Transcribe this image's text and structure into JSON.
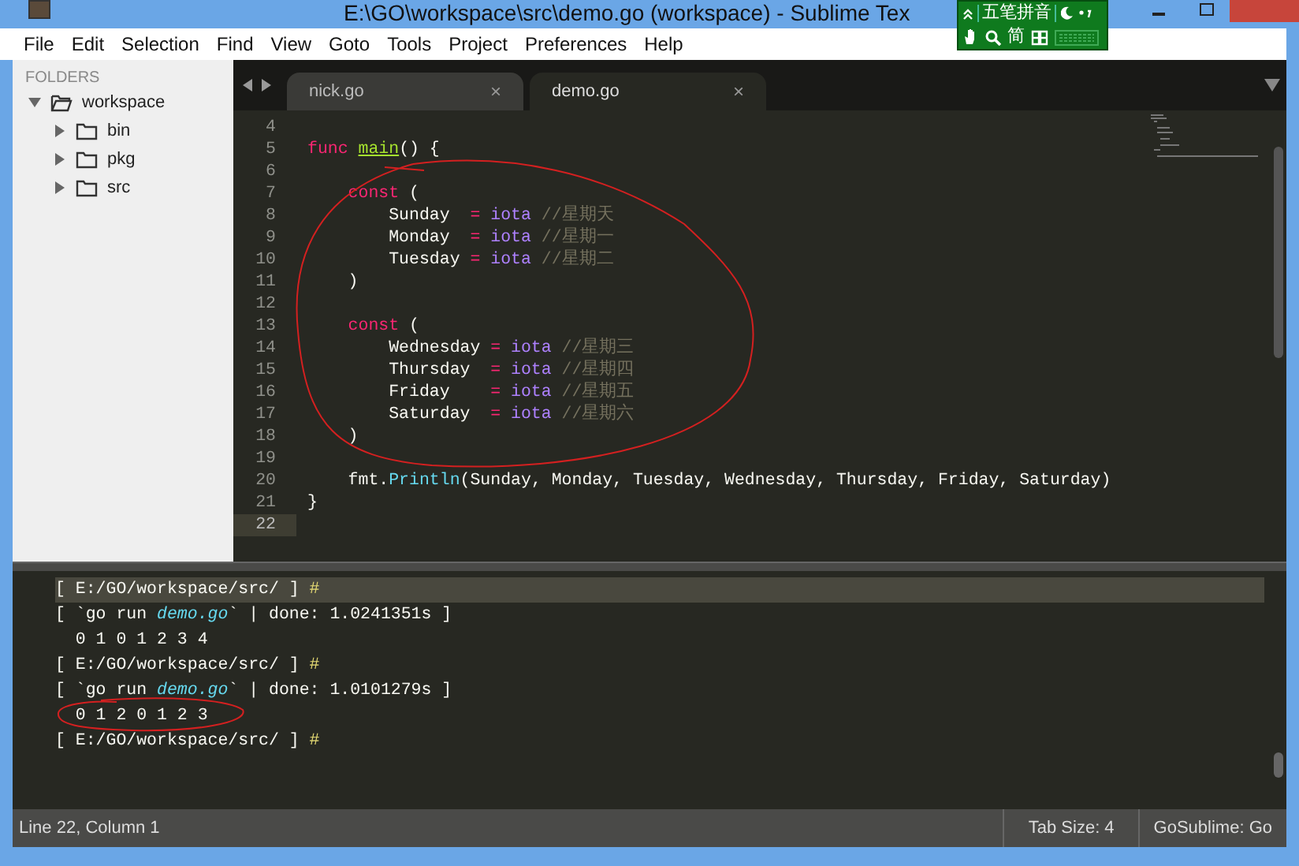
{
  "window": {
    "title": "E:\\GO\\workspace\\src\\demo.go (workspace) - Sublime Tex"
  },
  "ime_toolbar": {
    "mode": "五笔拼音",
    "charset": "简"
  },
  "menu": [
    "File",
    "Edit",
    "Selection",
    "Find",
    "View",
    "Goto",
    "Tools",
    "Project",
    "Preferences",
    "Help"
  ],
  "sidebar": {
    "heading": "FOLDERS",
    "tree": [
      {
        "label": "workspace",
        "expanded": true,
        "children": [
          {
            "label": "bin",
            "expanded": false
          },
          {
            "label": "pkg",
            "expanded": false
          },
          {
            "label": "src",
            "expanded": false
          }
        ]
      }
    ]
  },
  "tabs": [
    {
      "label": "nick.go",
      "selected": false,
      "close": "×"
    },
    {
      "label": "demo.go",
      "selected": true,
      "close": "×"
    }
  ],
  "editor": {
    "lines": [
      {
        "number": "4",
        "current": false
      },
      {
        "number": "5",
        "current": false,
        "tokens": [
          {
            "kind": "keyword",
            "text": "func "
          },
          {
            "kind": "function",
            "text": "main"
          },
          {
            "kind": "plain",
            "text": "() {"
          }
        ]
      },
      {
        "number": "6",
        "current": false
      },
      {
        "number": "7",
        "current": false,
        "tokens": [
          {
            "kind": "keyword",
            "text": "    const"
          },
          {
            "kind": "plain",
            "text": " ("
          }
        ]
      },
      {
        "number": "8",
        "current": false,
        "tokens": [
          {
            "kind": "plain",
            "text": "        Sunday  "
          },
          {
            "kind": "operator",
            "text": "= "
          },
          {
            "kind": "constant",
            "text": "iota "
          },
          {
            "kind": "comment",
            "text": "//星期天"
          }
        ]
      },
      {
        "number": "9",
        "current": false,
        "tokens": [
          {
            "kind": "plain",
            "text": "        Monday  "
          },
          {
            "kind": "operator",
            "text": "= "
          },
          {
            "kind": "constant",
            "text": "iota "
          },
          {
            "kind": "comment",
            "text": "//星期一"
          }
        ]
      },
      {
        "number": "10",
        "current": false,
        "tokens": [
          {
            "kind": "plain",
            "text": "        Tuesday "
          },
          {
            "kind": "operator",
            "text": "= "
          },
          {
            "kind": "constant",
            "text": "iota "
          },
          {
            "kind": "comment",
            "text": "//星期二"
          }
        ]
      },
      {
        "number": "11",
        "current": false,
        "tokens": [
          {
            "kind": "plain",
            "text": "    )"
          }
        ]
      },
      {
        "number": "12",
        "current": false
      },
      {
        "number": "13",
        "current": false,
        "tokens": [
          {
            "kind": "keyword",
            "text": "    const"
          },
          {
            "kind": "plain",
            "text": " ("
          }
        ]
      },
      {
        "number": "14",
        "current": false,
        "tokens": [
          {
            "kind": "plain",
            "text": "        Wednesday "
          },
          {
            "kind": "operator",
            "text": "= "
          },
          {
            "kind": "constant",
            "text": "iota "
          },
          {
            "kind": "comment",
            "text": "//星期三"
          }
        ]
      },
      {
        "number": "15",
        "current": false,
        "tokens": [
          {
            "kind": "plain",
            "text": "        Thursday  "
          },
          {
            "kind": "operator",
            "text": "= "
          },
          {
            "kind": "constant",
            "text": "iota "
          },
          {
            "kind": "comment",
            "text": "//星期四"
          }
        ]
      },
      {
        "number": "16",
        "current": false,
        "tokens": [
          {
            "kind": "plain",
            "text": "        Friday    "
          },
          {
            "kind": "operator",
            "text": "= "
          },
          {
            "kind": "constant",
            "text": "iota "
          },
          {
            "kind": "comment",
            "text": "//星期五"
          }
        ]
      },
      {
        "number": "17",
        "current": false,
        "tokens": [
          {
            "kind": "plain",
            "text": "        Saturday  "
          },
          {
            "kind": "operator",
            "text": "= "
          },
          {
            "kind": "constant",
            "text": "iota "
          },
          {
            "kind": "comment",
            "text": "//星期六"
          }
        ]
      },
      {
        "number": "18",
        "current": false,
        "tokens": [
          {
            "kind": "plain",
            "text": "    )"
          }
        ]
      },
      {
        "number": "19",
        "current": false
      },
      {
        "number": "20",
        "current": false,
        "tokens": [
          {
            "kind": "plain",
            "text": "    fmt."
          },
          {
            "kind": "support",
            "text": "Println"
          },
          {
            "kind": "plain",
            "text": "(Sunday, Monday, Tuesday, Wednesday, Thursday, Friday, Saturday)"
          }
        ]
      },
      {
        "number": "21",
        "current": false,
        "tokens": [
          {
            "kind": "plain",
            "text": "}"
          }
        ]
      },
      {
        "number": "22",
        "current": true
      }
    ]
  },
  "console": {
    "lines": [
      {
        "current": true,
        "tokens": [
          {
            "kind": "plain",
            "text": "[ E:/GO/workspace/src/ ] "
          },
          {
            "kind": "prompt",
            "text": "#"
          }
        ]
      },
      {
        "current": false,
        "tokens": [
          {
            "kind": "plain",
            "text": "[ `go run "
          },
          {
            "kind": "file",
            "text": "demo.go"
          },
          {
            "kind": "plain",
            "text": "` | done: 1.0241351s ]"
          }
        ]
      },
      {
        "current": false,
        "tokens": [
          {
            "kind": "plain",
            "text": "  0 1 0 1 2 3 4"
          }
        ]
      },
      {
        "current": false,
        "tokens": [
          {
            "kind": "plain",
            "text": "[ E:/GO/workspace/src/ ] "
          },
          {
            "kind": "prompt",
            "text": "#"
          }
        ]
      },
      {
        "current": false,
        "tokens": [
          {
            "kind": "plain",
            "text": "[ `go run "
          },
          {
            "kind": "file",
            "text": "demo.go"
          },
          {
            "kind": "plain",
            "text": "` | done: 1.0101279s ]"
          }
        ]
      },
      {
        "current": false,
        "tokens": [
          {
            "kind": "plain",
            "text": "  0 1 2 0 1 2 3"
          }
        ]
      },
      {
        "current": false,
        "tokens": [
          {
            "kind": "plain",
            "text": "[ E:/GO/workspace/src/ ] "
          },
          {
            "kind": "prompt",
            "text": "#"
          }
        ]
      }
    ]
  },
  "status_bar": {
    "position": "Line 22, Column 1",
    "tab_size": "Tab Size: 4",
    "syntax": "GoSublime: Go"
  }
}
